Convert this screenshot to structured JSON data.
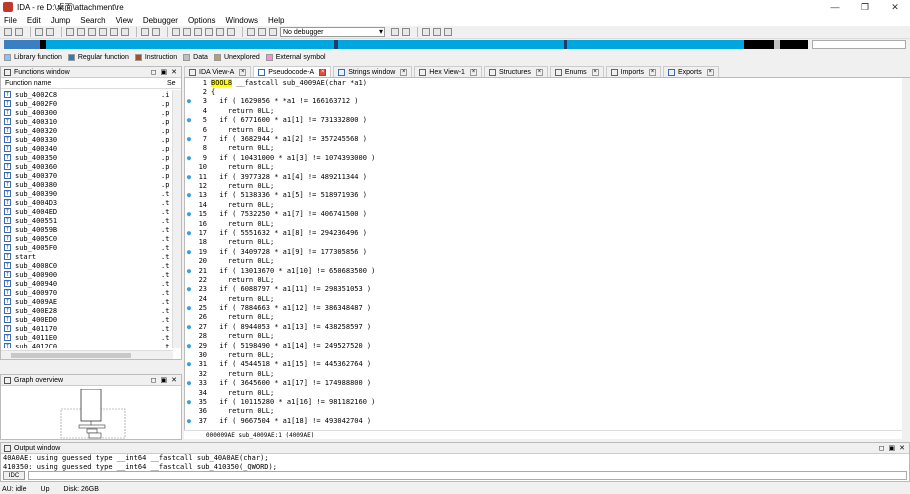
{
  "window": {
    "title": "IDA - re D:\\桌面\\attachment\\re",
    "minimize": "—",
    "restore": "❐",
    "close": "✕"
  },
  "menu": [
    "File",
    "Edit",
    "Jump",
    "Search",
    "View",
    "Debugger",
    "Options",
    "Windows",
    "Help"
  ],
  "toolbar": {
    "debugger_value": "No debugger"
  },
  "legend": [
    {
      "label": "Library function",
      "color": "#7fc7ff"
    },
    {
      "label": "Regular function",
      "color": "#2d7cc1"
    },
    {
      "label": "Instruction",
      "color": "#a0522d"
    },
    {
      "label": "Data",
      "color": "#c0c0c0"
    },
    {
      "label": "Unexplored",
      "color": "#b5a26a"
    },
    {
      "label": "External symbol",
      "color": "#ff8cd6"
    }
  ],
  "functions_window": {
    "title": "Functions window",
    "col_name": "Function name",
    "col_seg": "Se",
    "rows": [
      {
        "name": "sub_4002C8",
        "seg": ".i"
      },
      {
        "name": "sub_4002F0",
        "seg": ".p"
      },
      {
        "name": "sub_400300",
        "seg": ".p"
      },
      {
        "name": "sub_400310",
        "seg": ".p"
      },
      {
        "name": "sub_400320",
        "seg": ".p"
      },
      {
        "name": "sub_400330",
        "seg": ".p"
      },
      {
        "name": "sub_400340",
        "seg": ".p"
      },
      {
        "name": "sub_400350",
        "seg": ".p"
      },
      {
        "name": "sub_400360",
        "seg": ".p"
      },
      {
        "name": "sub_400370",
        "seg": ".p"
      },
      {
        "name": "sub_400380",
        "seg": ".p"
      },
      {
        "name": "sub_400390",
        "seg": ".t"
      },
      {
        "name": "sub_4004D3",
        "seg": ".t"
      },
      {
        "name": "sub_4004ED",
        "seg": ".t"
      },
      {
        "name": "sub_400551",
        "seg": ".t"
      },
      {
        "name": "sub_40059B",
        "seg": ".t"
      },
      {
        "name": "sub_4005C0",
        "seg": ".t"
      },
      {
        "name": "sub_4005F0",
        "seg": ".t"
      },
      {
        "name": "start",
        "seg": ".t"
      },
      {
        "name": "sub_4008C0",
        "seg": ".t"
      },
      {
        "name": "sub_400900",
        "seg": ".t"
      },
      {
        "name": "sub_400940",
        "seg": ".t"
      },
      {
        "name": "sub_400970",
        "seg": ".t"
      },
      {
        "name": "sub_4009AE",
        "seg": ".t"
      },
      {
        "name": "sub_400E28",
        "seg": ".t"
      },
      {
        "name": "sub_400ED0",
        "seg": ".t"
      },
      {
        "name": "sub_401170",
        "seg": ".t"
      },
      {
        "name": "sub_4011E0",
        "seg": ".t"
      },
      {
        "name": "sub_4012C0",
        "seg": ".t"
      }
    ]
  },
  "graph_overview": {
    "title": "Graph overview"
  },
  "tabs": [
    {
      "label": "IDA View-A",
      "active": false
    },
    {
      "label": "Pseudocode-A",
      "active": true
    },
    {
      "label": "Strings window",
      "active": false
    },
    {
      "label": "Hex View-1",
      "active": false
    },
    {
      "label": "Structures",
      "active": false
    },
    {
      "label": "Enums",
      "active": false
    },
    {
      "label": "Imports",
      "active": false
    },
    {
      "label": "Exports",
      "active": false
    }
  ],
  "pseudocode": {
    "lines": [
      {
        "n": "1",
        "t": "BOOL8 __fastcall sub_4009AE(char *a1)",
        "dot": false,
        "hl": "BOOL8"
      },
      {
        "n": "2",
        "t": "{",
        "dot": false
      },
      {
        "n": "3",
        "t": "  if ( 1629056 * *a1 != 166163712 )",
        "dot": true
      },
      {
        "n": "4",
        "t": "    return 0LL;",
        "dot": false
      },
      {
        "n": "5",
        "t": "  if ( 6771600 * a1[1] != 731332800 )",
        "dot": true
      },
      {
        "n": "6",
        "t": "    return 0LL;",
        "dot": false
      },
      {
        "n": "7",
        "t": "  if ( 3682944 * a1[2] != 357245568 )",
        "dot": true
      },
      {
        "n": "8",
        "t": "    return 0LL;",
        "dot": false
      },
      {
        "n": "9",
        "t": "  if ( 10431000 * a1[3] != 1074393000 )",
        "dot": true
      },
      {
        "n": "10",
        "t": "    return 0LL;",
        "dot": false
      },
      {
        "n": "11",
        "t": "  if ( 3977328 * a1[4] != 489211344 )",
        "dot": true
      },
      {
        "n": "12",
        "t": "    return 0LL;",
        "dot": false
      },
      {
        "n": "13",
        "t": "  if ( 5138336 * a1[5] != 518971936 )",
        "dot": true
      },
      {
        "n": "14",
        "t": "    return 0LL;",
        "dot": false
      },
      {
        "n": "15",
        "t": "  if ( 7532250 * a1[7] != 406741500 )",
        "dot": true
      },
      {
        "n": "16",
        "t": "    return 0LL;",
        "dot": false
      },
      {
        "n": "17",
        "t": "  if ( 5551632 * a1[8] != 294236496 )",
        "dot": true
      },
      {
        "n": "18",
        "t": "    return 0LL;",
        "dot": false
      },
      {
        "n": "19",
        "t": "  if ( 3409728 * a1[9] != 177305856 )",
        "dot": true
      },
      {
        "n": "20",
        "t": "    return 0LL;",
        "dot": false
      },
      {
        "n": "21",
        "t": "  if ( 13013670 * a1[10] != 650683500 )",
        "dot": true
      },
      {
        "n": "22",
        "t": "    return 0LL;",
        "dot": false
      },
      {
        "n": "23",
        "t": "  if ( 6088797 * a1[11] != 298351053 )",
        "dot": true
      },
      {
        "n": "24",
        "t": "    return 0LL;",
        "dot": false
      },
      {
        "n": "25",
        "t": "  if ( 7884663 * a1[12] != 386348487 )",
        "dot": true
      },
      {
        "n": "26",
        "t": "    return 0LL;",
        "dot": false
      },
      {
        "n": "27",
        "t": "  if ( 8944053 * a1[13] != 438258597 )",
        "dot": true
      },
      {
        "n": "28",
        "t": "    return 0LL;",
        "dot": false
      },
      {
        "n": "29",
        "t": "  if ( 5198490 * a1[14] != 249527520 )",
        "dot": true
      },
      {
        "n": "30",
        "t": "    return 0LL;",
        "dot": false
      },
      {
        "n": "31",
        "t": "  if ( 4544518 * a1[15] != 445362764 )",
        "dot": true
      },
      {
        "n": "32",
        "t": "    return 0LL;",
        "dot": false
      },
      {
        "n": "33",
        "t": "  if ( 3645600 * a1[17] != 174988800 )",
        "dot": true
      },
      {
        "n": "34",
        "t": "    return 0LL;",
        "dot": false
      },
      {
        "n": "35",
        "t": "  if ( 10115280 * a1[16] != 981182160 )",
        "dot": true
      },
      {
        "n": "36",
        "t": "    return 0LL;",
        "dot": false
      },
      {
        "n": "37",
        "t": "  if ( 9667504 * a1[18] != 493042704 )",
        "dot": true
      }
    ],
    "status": "000009AE sub_4009AE:1 (4009AE)"
  },
  "output_window": {
    "title": "Output window",
    "lines": [
      "40A0AE: using guessed type __int64 __fastcall sub_40A0AE(char);",
      "410350: using guessed type __int64 __fastcall sub_410350(_QWORD);"
    ],
    "idc_label": "IDC"
  },
  "statusbar": {
    "au": "AU:  idle",
    "dir": "Up",
    "disk": "Disk: 26GB"
  }
}
